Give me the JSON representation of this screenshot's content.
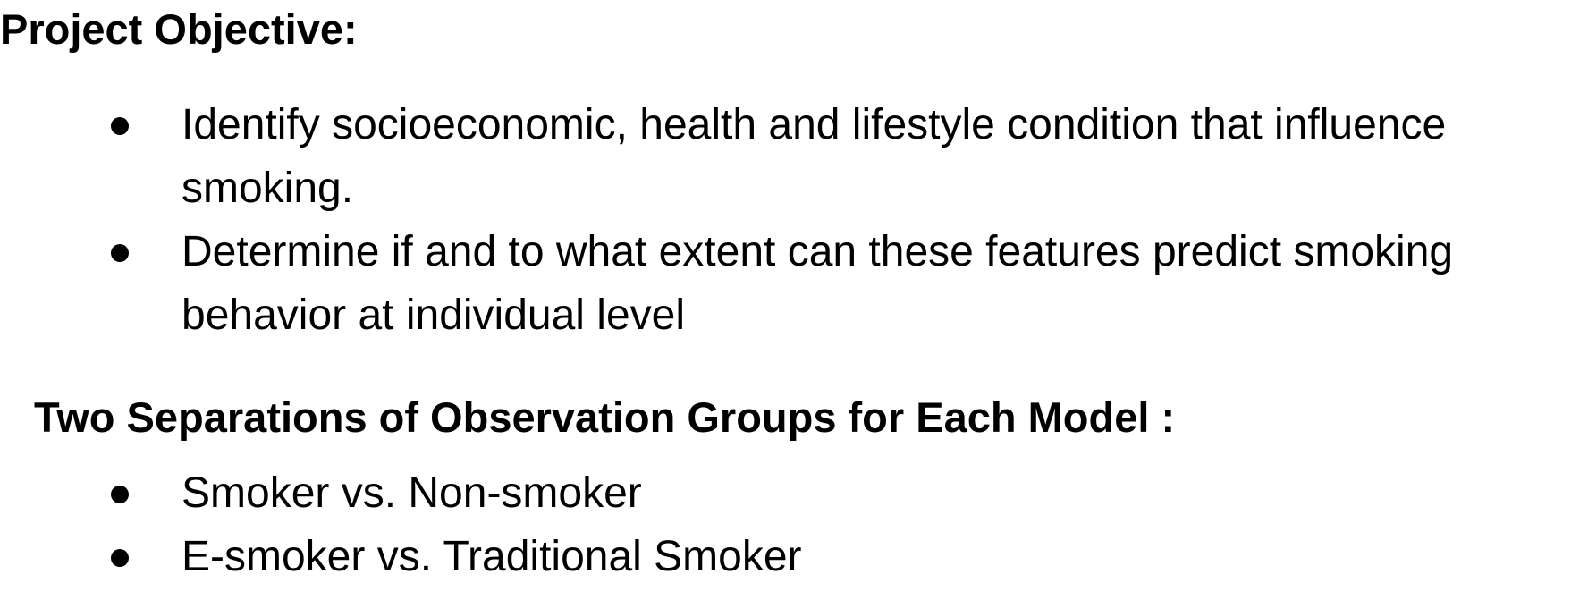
{
  "objective": {
    "heading": "Project Objective:",
    "items": [
      {
        "text": "Identify socioeconomic, health and lifestyle condition that influence smoking."
      },
      {
        "text": "Determine if and to what extent can these features predict smoking behavior at individual level"
      }
    ]
  },
  "groups": {
    "heading": "Two Separations of Observation Groups for Each Model :",
    "items": [
      {
        "text": "Smoker vs. Non-smoker"
      },
      {
        "text": "E-smoker vs. Traditional Smoker"
      }
    ]
  }
}
